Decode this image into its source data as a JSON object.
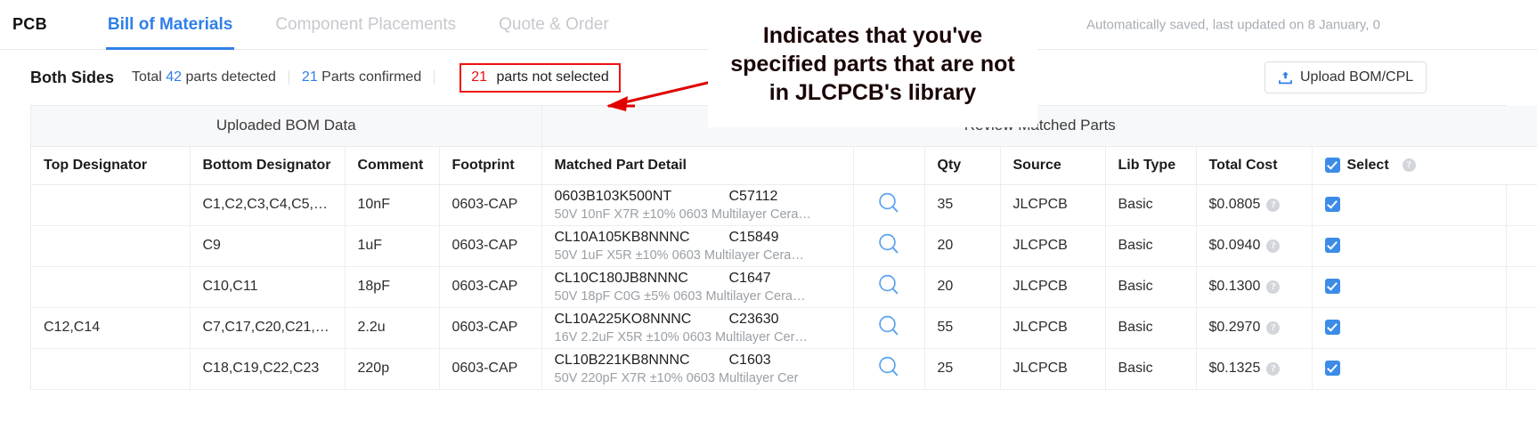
{
  "header": {
    "brand": "PCB",
    "tabs": [
      {
        "label": "Bill of Materials",
        "active": true
      },
      {
        "label": "Component Placements",
        "active": false
      },
      {
        "label": "Quote & Order",
        "active": false
      }
    ],
    "autosave": "Automatically saved, last updated on 8 January, 0"
  },
  "toolbar": {
    "side_label": "Both Sides",
    "total_prefix": "Total",
    "total_count": "42",
    "total_suffix": "parts detected",
    "confirmed_count": "21",
    "confirmed_label": "Parts confirmed",
    "notselected_count": "21",
    "notselected_label": "parts not selected",
    "upload_label": "Upload BOM/CPL",
    "upload_icon": "upload-icon",
    "alert_color": "#ee1111",
    "accent_color": "#2f7fe8"
  },
  "annotation": {
    "text": "Indicates that you've\nspecified parts that are not\nin JLCPCB's library",
    "arrow_color": "#e00000"
  },
  "table": {
    "groups": [
      {
        "label": "Uploaded BOM Data",
        "span": 4
      },
      {
        "label": "Review Matched Parts",
        "span": 6
      }
    ],
    "columns": [
      "Top Designator",
      "Bottom Designator",
      "Comment",
      "Footprint",
      "Matched Part Detail",
      "",
      "Qty",
      "Source",
      "Lib Type",
      "Total Cost"
    ],
    "select_header": "Select",
    "rows": [
      {
        "top_designator": "",
        "bottom_designator": "C1,C2,C3,C4,C5,…",
        "comment": "10nF",
        "footprint": "0603-CAP",
        "mpn": "0603B103K500NT",
        "lcsc": "C57112",
        "description": "50V 10nF X7R ±10% 0603 Multilayer Cera…",
        "qty": "35",
        "source": "JLCPCB",
        "lib_type": "Basic",
        "total_cost": "$0.0805",
        "selected": true
      },
      {
        "top_designator": "",
        "bottom_designator": "C9",
        "comment": "1uF",
        "footprint": "0603-CAP",
        "mpn": "CL10A105KB8NNNC",
        "lcsc": "C15849",
        "description": "50V 1uF X5R ±10% 0603 Multilayer Cera…",
        "qty": "20",
        "source": "JLCPCB",
        "lib_type": "Basic",
        "total_cost": "$0.0940",
        "selected": true
      },
      {
        "top_designator": "",
        "bottom_designator": "C10,C11",
        "comment": "18pF",
        "footprint": "0603-CAP",
        "mpn": "CL10C180JB8NNNC",
        "lcsc": "C1647",
        "description": "50V 18pF C0G ±5% 0603 Multilayer Cera…",
        "qty": "20",
        "source": "JLCPCB",
        "lib_type": "Basic",
        "total_cost": "$0.1300",
        "selected": true
      },
      {
        "top_designator": "C12,C14",
        "bottom_designator": "C7,C17,C20,C21,…",
        "comment": "2.2u",
        "footprint": "0603-CAP",
        "mpn": "CL10A225KO8NNNC",
        "lcsc": "C23630",
        "description": "16V 2.2uF X5R ±10% 0603 Multilayer Cer…",
        "qty": "55",
        "source": "JLCPCB",
        "lib_type": "Basic",
        "total_cost": "$0.2970",
        "selected": true
      },
      {
        "top_designator": "",
        "bottom_designator": "C18,C19,C22,C23",
        "comment": "220p",
        "footprint": "0603-CAP",
        "mpn": "CL10B221KB8NNNC",
        "lcsc": "C1603",
        "description": "50V 220pF X7R ±10% 0603 Multilayer Cer",
        "qty": "25",
        "source": "JLCPCB",
        "lib_type": "Basic",
        "total_cost": "$0.1325",
        "selected": true
      }
    ]
  }
}
